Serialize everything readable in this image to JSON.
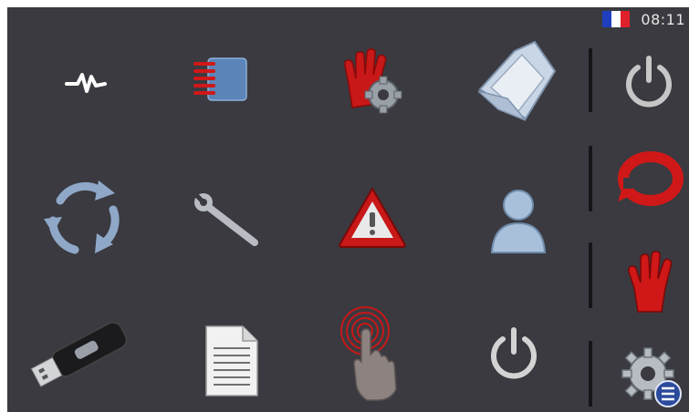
{
  "status_bar": {
    "language_flag": "flag-france",
    "time": "08:11",
    "flag_colors": [
      "#1f3fbf",
      "#ffffff",
      "#e0202a"
    ]
  },
  "grid_icons": [
    "pulse-icon",
    "red-notebook-icon",
    "hand-gear-icon",
    "open-folder-icon",
    "refresh-cycle-icon",
    "wrench-icon",
    "warning-icon",
    "user-icon",
    "usb-drive-icon",
    "document-icon",
    "touch-hand-icon",
    "power-icon"
  ],
  "side_icons": [
    "power-icon",
    "red-rotate-icon",
    "red-hand-icon",
    "gear-list-icon"
  ],
  "colors": {
    "background": "#3a3a40",
    "accent_red": "#d01818",
    "icon_gray": "#c8c8c8"
  }
}
